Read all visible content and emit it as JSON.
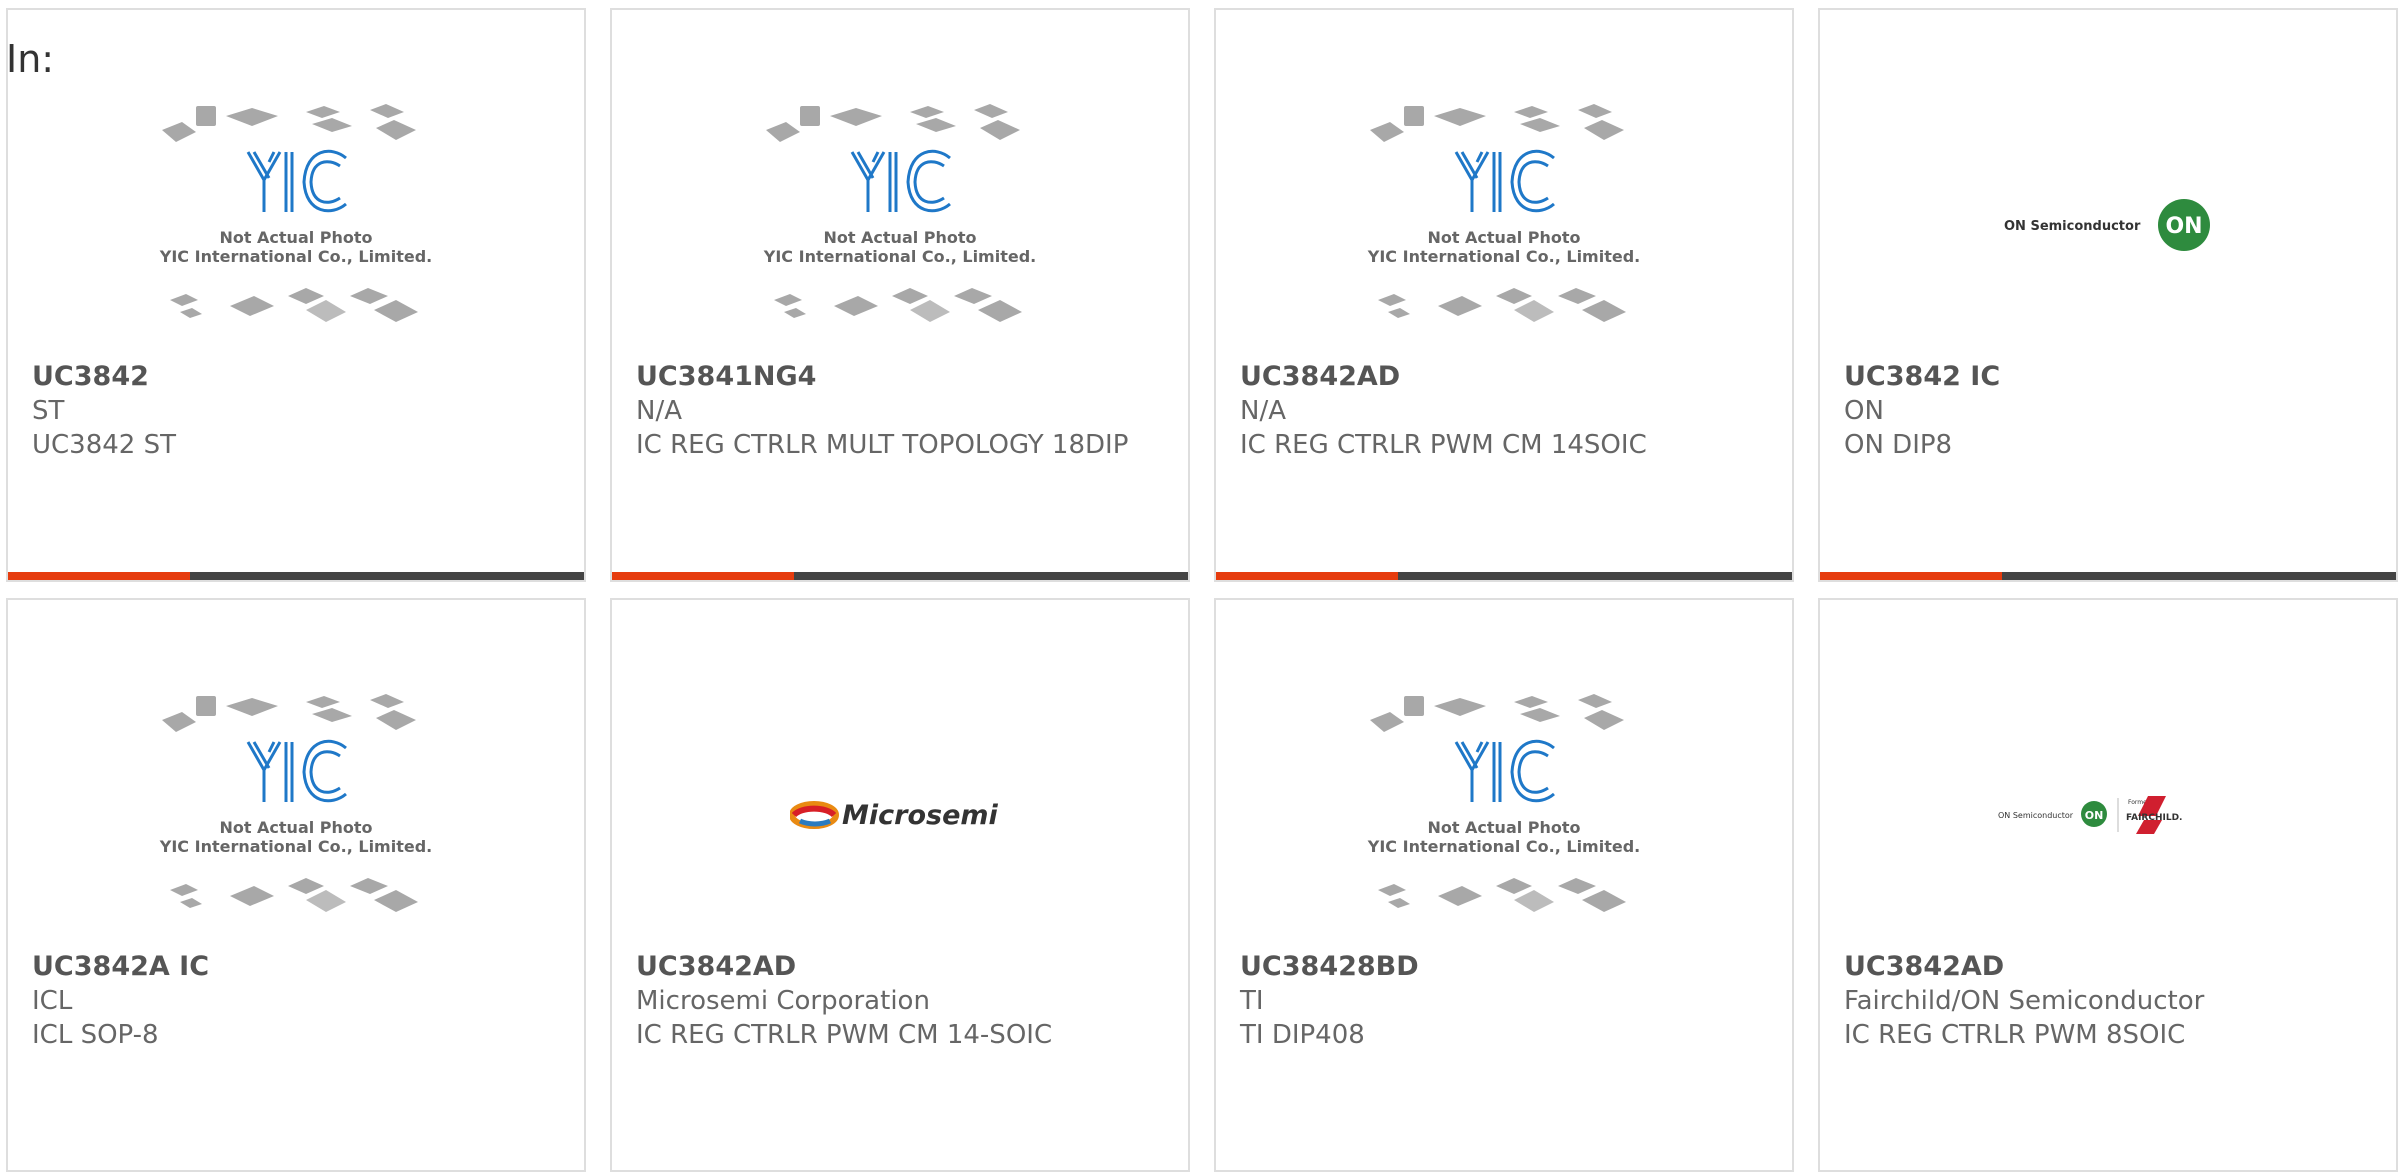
{
  "filter_label": "In:",
  "placeholder_caption": {
    "line1": "Not Actual Photo",
    "line2": "YIC International Co., Limited."
  },
  "colors": {
    "accent": "#e63c0e",
    "bar": "#444444",
    "border": "#dedede",
    "yic_logo": "#1f78c8",
    "on_green": "#2e8b3e",
    "fairchild_red": "#d01f2f"
  },
  "products": [
    {
      "part": "UC3842",
      "manufacturer": "ST",
      "description": "UC3842 ST",
      "image": "yic-placeholder"
    },
    {
      "part": "UC3841NG4",
      "manufacturer": "N/A",
      "description": "IC REG CTRLR MULT TOPOLOGY 18DIP",
      "image": "yic-placeholder"
    },
    {
      "part": "UC3842AD",
      "manufacturer": "N/A",
      "description": "IC REG CTRLR PWM CM 14SOIC",
      "image": "yic-placeholder"
    },
    {
      "part": "UC3842 IC",
      "manufacturer": "ON",
      "description": "ON DIP8",
      "image": "on-semiconductor-logo"
    },
    {
      "part": "UC3842A IC",
      "manufacturer": "ICL",
      "description": "ICL SOP-8",
      "image": "yic-placeholder"
    },
    {
      "part": "UC3842AD",
      "manufacturer": "Microsemi Corporation",
      "description": "IC REG CTRLR PWM CM 14-SOIC",
      "image": "microsemi-logo"
    },
    {
      "part": "UC38428BD",
      "manufacturer": "TI",
      "description": "TI DIP408",
      "image": "yic-placeholder"
    },
    {
      "part": "UC3842AD",
      "manufacturer": "Fairchild/ON Semiconductor",
      "description": "IC REG CTRLR PWM 8SOIC",
      "image": "on-fairchild-logo"
    }
  ],
  "logos": {
    "on_text": "ON Semiconductor",
    "on_mark": "ON",
    "microsemi": "Microsemi",
    "formerly": "Formerly",
    "fairchild": "FAIRCHILD."
  }
}
